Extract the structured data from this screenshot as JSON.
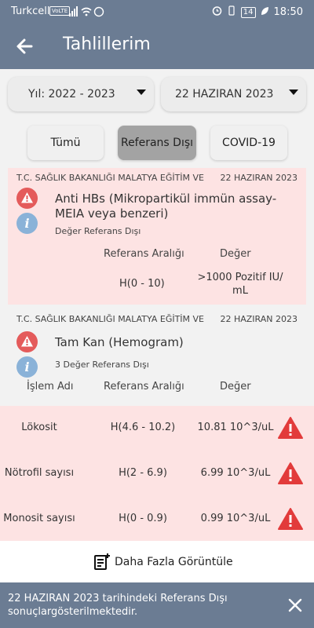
{
  "status_bar": {
    "carrier": "Turkcell",
    "volte": "VoLTE",
    "battery": "14",
    "time": "18:50"
  },
  "header": {
    "title": "Tahlillerim",
    "back_icon": "arrow-left-icon"
  },
  "filters": {
    "year": "Yıl: 2022 - 2023",
    "date": "22 HAZIRAN 2023"
  },
  "tabs": [
    {
      "label": "Tümü",
      "active": false
    },
    {
      "label": "Referans Dışı",
      "active": true
    },
    {
      "label": "COVID-19",
      "active": false
    }
  ],
  "card1": {
    "institution": "T.C. SAĞLIK BAKANLIĞI MALATYA EĞİTİM VE",
    "date": "22 HAZIRAN 2023",
    "test": "Anti HBs (Mikropartikül immün assay-MEIA veya benzeri)",
    "status": "Değer Referans Dışı",
    "col_range": "Referans Aralığı",
    "col_value": "Değer",
    "range": "H(0 - 10)",
    "value": ">1000 Pozitif IU/ mL"
  },
  "card2": {
    "institution": "T.C. SAĞLIK BAKANLIĞI MALATYA EĞİTİM VE",
    "date": "22 HAZIRAN 2023",
    "test": "Tam Kan (Hemogram)",
    "status": "3 Değer Referans Dışı",
    "col_name": "İşlem Adı",
    "col_range": "Referans Aralığı",
    "col_value": "Değer"
  },
  "rows": [
    {
      "name": "Lökosit",
      "range": "H(4.6 - 10.2)",
      "value": "10.81 10^3/uL"
    },
    {
      "name": "Nötrofil sayısı",
      "range": "H(2 - 6.9)",
      "value": "6.99 10^3/uL"
    },
    {
      "name": "Monosit sayısı",
      "range": "H(0 - 0.9)",
      "value": "0.99 10^3/uL"
    }
  ],
  "more": {
    "label": "Daha Fazla Görüntüle"
  },
  "snackbar": {
    "message": "22 HAZIRAN 2023 tarihindeki Referans Dışı sonuçlargösterilmektedir."
  },
  "colors": {
    "primary": "#6b7c93",
    "alert_bg": "#fde3e3",
    "warning": "#e45b5b",
    "info": "#8ab2d8"
  }
}
